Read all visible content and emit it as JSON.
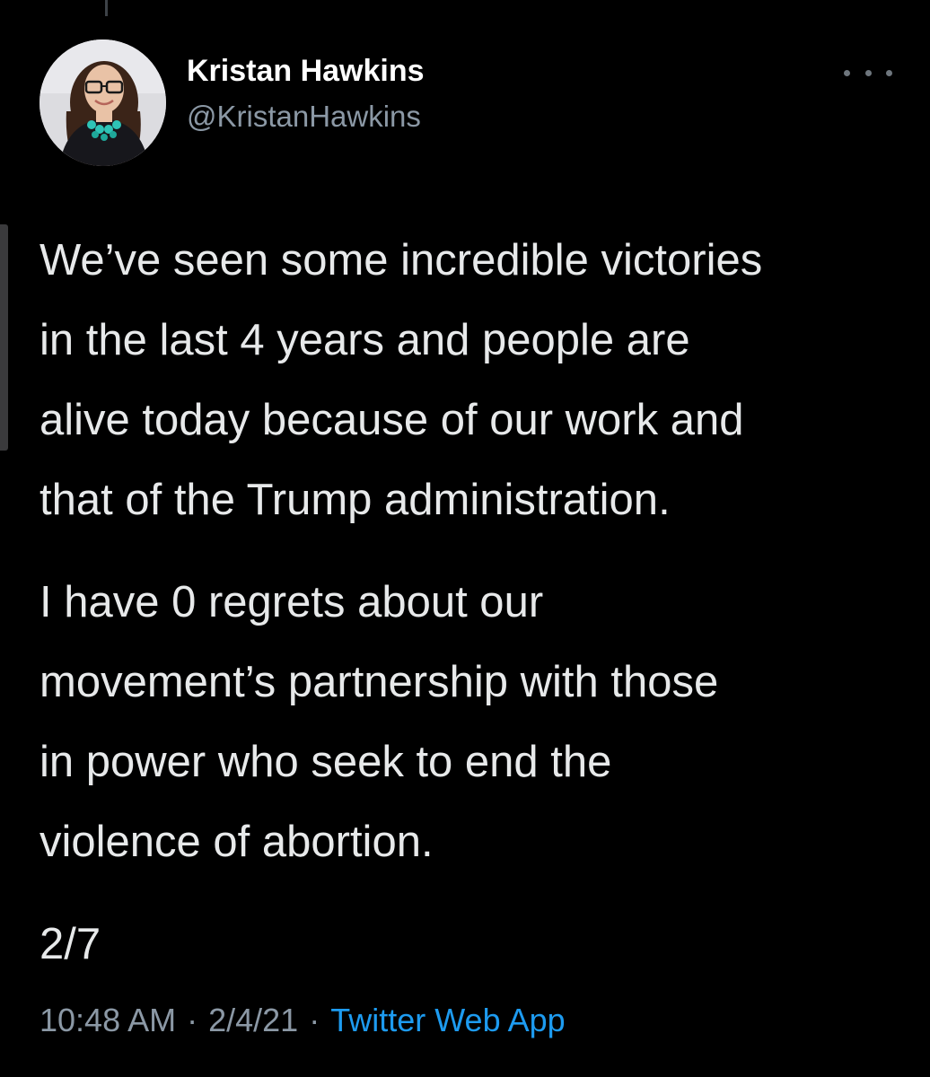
{
  "tweet": {
    "author": {
      "name": "Kristan Hawkins",
      "handle": "@KristanHawkins"
    },
    "paragraphs": [
      "We’ve seen some incredible victories\nin the last 4 years and people are\nalive today because of our work and\nthat of the Trump administration.",
      "I have 0 regrets about our\nmovement’s partnership with those\nin power who seek to end the\nviolence of abortion.",
      "2/7"
    ],
    "footer": {
      "time": "10:48 AM",
      "separator": "·",
      "date": "2/4/21",
      "source": "Twitter Web App"
    }
  },
  "icons": {
    "more": "more-horizontal-icon"
  },
  "colors": {
    "background": "#000000",
    "text": "#e7e9ea",
    "secondary_text": "#8b98a5",
    "link": "#1d9bf0"
  }
}
